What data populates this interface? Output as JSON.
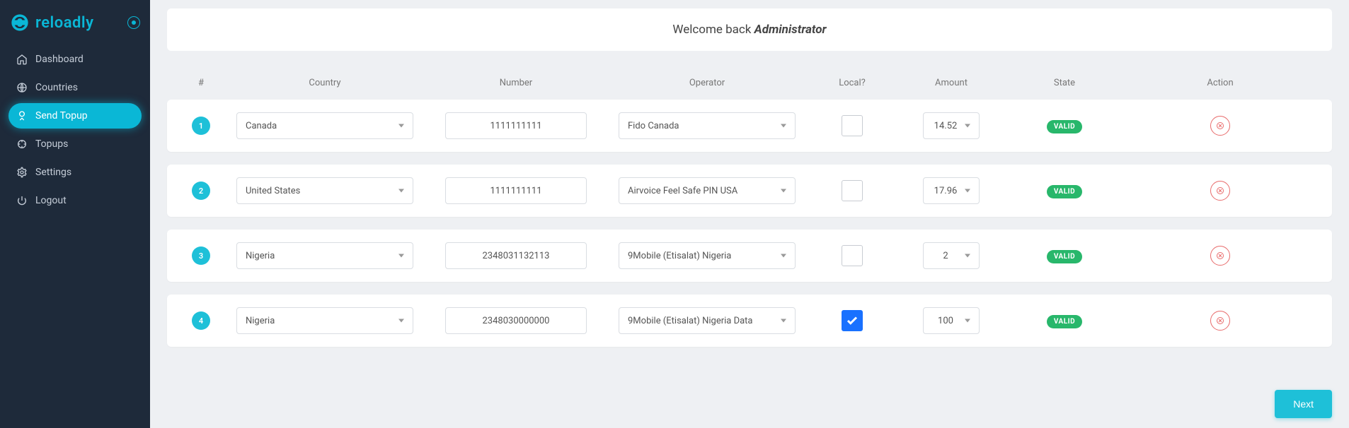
{
  "brand": {
    "name": "reloadly"
  },
  "sidebar": {
    "items": [
      {
        "label": "Dashboard",
        "icon": "home-icon",
        "active": false
      },
      {
        "label": "Countries",
        "icon": "globe-icon",
        "active": false
      },
      {
        "label": "Send Topup",
        "icon": "topup-icon",
        "active": true
      },
      {
        "label": "Topups",
        "icon": "spinner-icon",
        "active": false
      },
      {
        "label": "Settings",
        "icon": "gear-icon",
        "active": false
      },
      {
        "label": "Logout",
        "icon": "power-icon",
        "active": false
      }
    ]
  },
  "welcome": {
    "prefix": "Welcome back ",
    "name": "Administrator"
  },
  "columns": {
    "idx": "#",
    "country": "Country",
    "number": "Number",
    "operator": "Operator",
    "local": "Local?",
    "amount": "Amount",
    "state": "State",
    "action": "Action"
  },
  "rows": [
    {
      "idx": "1",
      "country": "Canada",
      "number": "1111111111",
      "operator": "Fido Canada",
      "local": false,
      "amount": "14.52",
      "state": "VALID"
    },
    {
      "idx": "2",
      "country": "United States",
      "number": "1111111111",
      "operator": "Airvoice Feel Safe PIN USA",
      "local": false,
      "amount": "17.96",
      "state": "VALID"
    },
    {
      "idx": "3",
      "country": "Nigeria",
      "number": "2348031132113",
      "operator": "9Mobile (Etisalat) Nigeria",
      "local": false,
      "amount": "2",
      "state": "VALID"
    },
    {
      "idx": "4",
      "country": "Nigeria",
      "number": "2348030000000",
      "operator": "9Mobile (Etisalat) Nigeria Data",
      "local": true,
      "amount": "100",
      "state": "VALID"
    }
  ],
  "buttons": {
    "next": "Next"
  }
}
